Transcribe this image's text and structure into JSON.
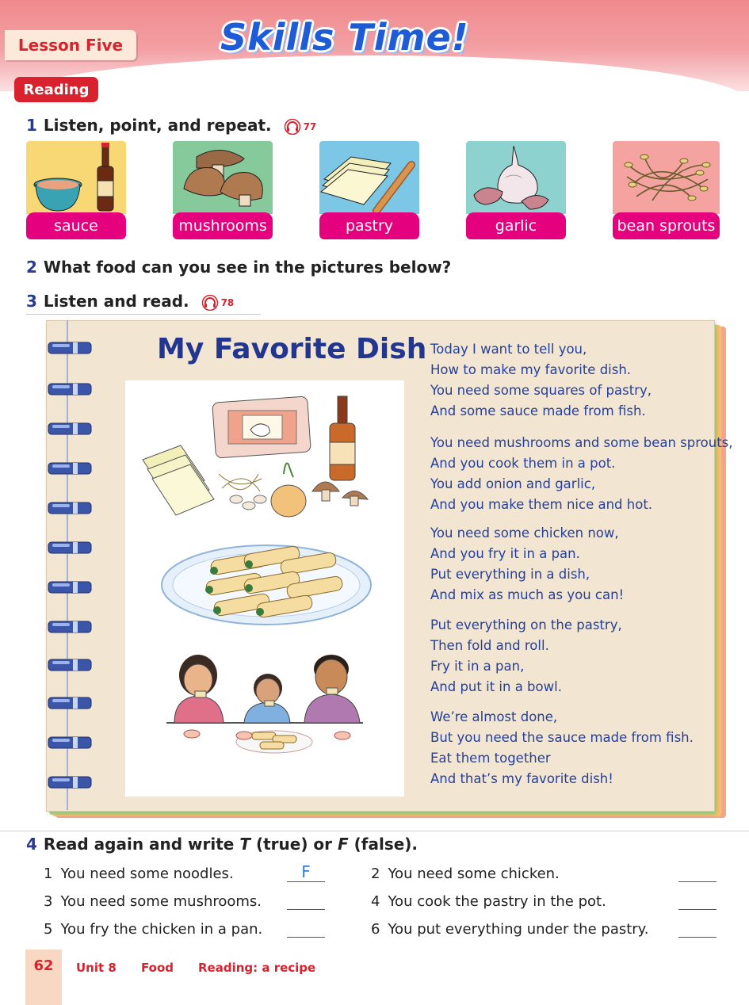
{
  "header": {
    "lesson": "Lesson Five",
    "title": "Skills Time!",
    "section": "Reading"
  },
  "q1": {
    "num": "1",
    "text": "Listen, point, and repeat.",
    "audio": "77"
  },
  "foods": [
    {
      "label": "sauce",
      "icon": "sauce-picture",
      "bg": "#f8d775"
    },
    {
      "label": "mushrooms",
      "icon": "mushrooms-picture",
      "bg": "#86c99a"
    },
    {
      "label": "pastry",
      "icon": "pastry-picture",
      "bg": "#7cc6e6"
    },
    {
      "label": "garlic",
      "icon": "garlic-picture",
      "bg": "#8ed2cf"
    },
    {
      "label": "bean sprouts",
      "icon": "bean-sprouts-picture",
      "bg": "#f4a3a0"
    }
  ],
  "q2": {
    "num": "2",
    "text": "What food can you see in the pictures below?"
  },
  "q3": {
    "num": "3",
    "text": "Listen and read.",
    "audio": "78"
  },
  "notebook": {
    "title": "My Favorite Dish",
    "stanzas": [
      [
        "Today I want to tell you,",
        "How to make my favorite dish.",
        "You need some squares of pastry,",
        "And some sauce made from fish."
      ],
      [
        "You need mushrooms and some bean sprouts,",
        "And you cook them in a pot.",
        "You add onion and garlic,",
        "And you make them nice and hot."
      ],
      [
        "You need some chicken now,",
        "And you fry it in a pan.",
        "Put everything in a dish,",
        "And mix as much as you can!"
      ],
      [
        "Put everything on the pastry,",
        "Then fold and roll.",
        "Fry it in a pan,",
        "And put it in a bowl."
      ],
      [
        "We’re almost done,",
        "But you need the sauce made from fish.",
        "Eat them together",
        "And that’s my favorite dish!"
      ]
    ]
  },
  "q4": {
    "num": "4",
    "text_pre": "Read again and write ",
    "t": "T",
    "text_mid": " (true) or ",
    "f": "F",
    "text_post": " (false).",
    "items": [
      {
        "n": "1",
        "text": "You need some noodles.",
        "answer": "F"
      },
      {
        "n": "2",
        "text": "You need some chicken.",
        "answer": ""
      },
      {
        "n": "3",
        "text": "You need some mushrooms.",
        "answer": ""
      },
      {
        "n": "4",
        "text": "You cook the pastry in the pot.",
        "answer": ""
      },
      {
        "n": "5",
        "text": "You fry the chicken in a pan.",
        "answer": ""
      },
      {
        "n": "6",
        "text": "You put everything under the pastry.",
        "answer": ""
      }
    ]
  },
  "footer": {
    "page": "62",
    "unit": "Unit 8",
    "topic": "Food",
    "skill": "Reading: a recipe"
  },
  "colors": {
    "accent_red": "#d8232e",
    "label_pink": "#e5007e",
    "poem_blue": "#25409b",
    "title_blue": "#1e5bd7"
  }
}
